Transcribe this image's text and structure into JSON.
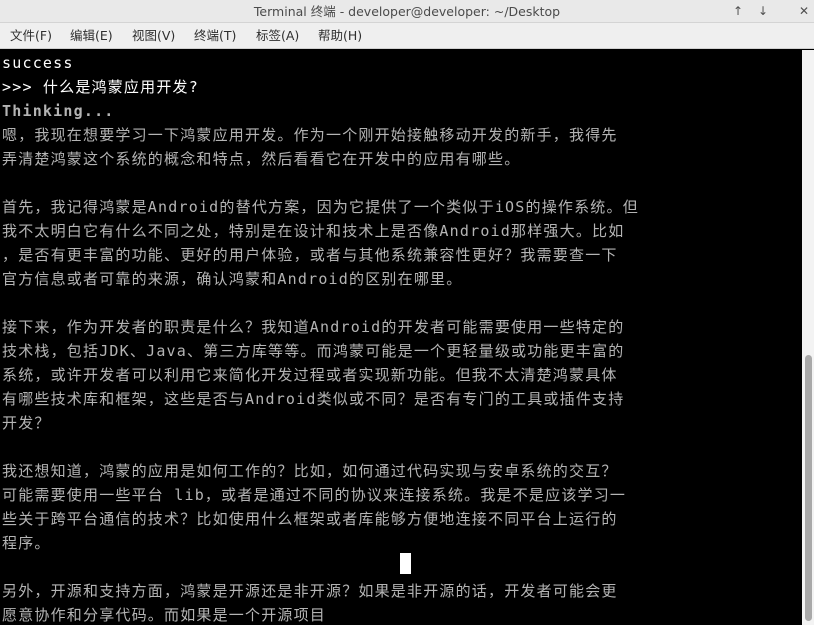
{
  "window": {
    "title": "Terminal 终端 - developer@developer: ~/Desktop",
    "controls": {
      "up": "↑",
      "down": "↓",
      "close": "✕"
    }
  },
  "menu": [
    "文件(F)",
    "编辑(E)",
    "视图(V)",
    "终端(T)",
    "标签(A)",
    "帮助(H)"
  ],
  "terminal": {
    "lines": [
      "success",
      ">>> 什么是鸿蒙应用开发?",
      "Thinking...",
      "嗯，我现在想要学习一下鸿蒙应用开发。作为一个刚开始接触移动开发的新手，我得先",
      "弄清楚鸿蒙这个系统的概念和特点，然后看看它在开发中的应用有哪些。",
      "",
      "首先，我记得鸿蒙是Android的替代方案，因为它提供了一个类似于iOS的操作系统。但",
      "我不太明白它有什么不同之处，特别是在设计和技术上是否像Android那样强大。比如",
      "，是否有更丰富的功能、更好的用户体验，或者与其他系统兼容性更好？我需要查一下",
      "官方信息或者可靠的来源，确认鸿蒙和Android的区别在哪里。",
      "",
      "接下来，作为开发者的职责是什么？我知道Android的开发者可能需要使用一些特定的",
      "技术栈，包括JDK、Java、第三方库等等。而鸿蒙可能是一个更轻量级或功能更丰富的",
      "系统，或许开发者可以利用它来简化开发过程或者实现新功能。但我不太清楚鸿蒙具体",
      "有哪些技术库和框架，这些是否与Android类似或不同？是否有专门的工具或插件支持",
      "开发？",
      "",
      "我还想知道，鸿蒙的应用是如何工作的？比如，如何通过代码实现与安卓系统的交互？",
      "可能需要使用一些平台 lib，或者是通过不同的协议来连接系统。我是不是应该学习一",
      "些关于跨平台通信的技术？比如使用什么框架或者库能够方便地连接不同平台上运行的",
      "程序。",
      "",
      "另外，开源和支持方面，鸿蒙是开源还是非开源？如果是非开源的话，开发者可能会更",
      "愿意协作和分享代码。而如果是一个开源项目"
    ]
  }
}
